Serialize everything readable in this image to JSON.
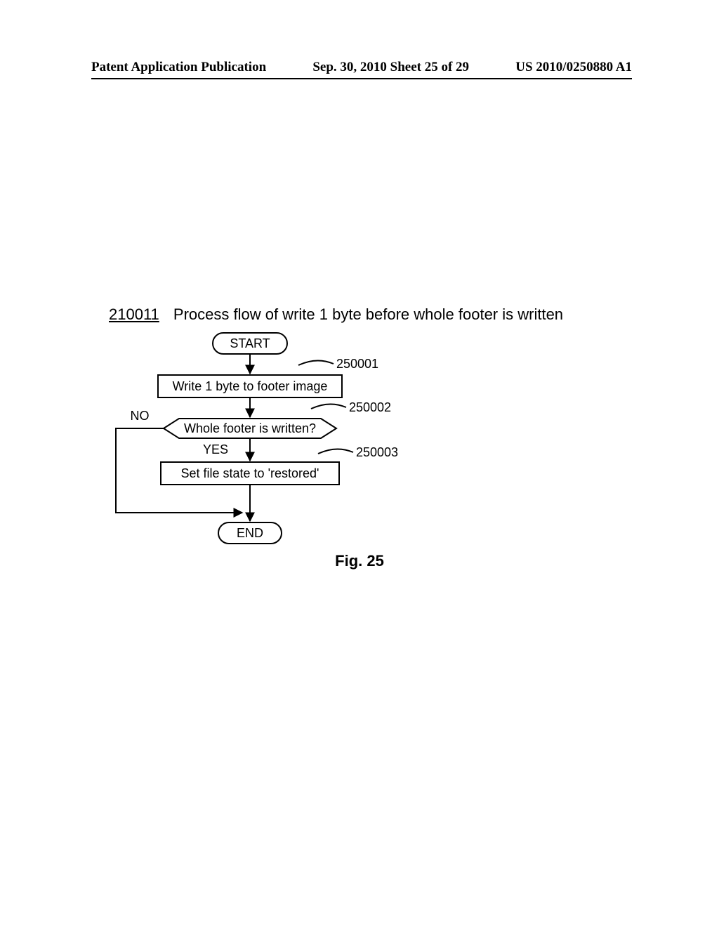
{
  "header": {
    "left": "Patent Application Publication",
    "center": "Sep. 30, 2010  Sheet 25 of 29",
    "right": "US 2010/0250880 A1"
  },
  "title": {
    "refnum": "210011",
    "text": "Process flow of write 1 byte before whole footer is written"
  },
  "flow": {
    "start": "START",
    "step1": {
      "label": "Write 1 byte to footer image",
      "ref": "250001"
    },
    "decision": {
      "label": "Whole footer is written?",
      "ref": "250002",
      "no": "NO",
      "yes": "YES"
    },
    "step3": {
      "label": "Set file state to 'restored'",
      "ref": "250003"
    },
    "end": "END"
  },
  "caption": "Fig. 25"
}
